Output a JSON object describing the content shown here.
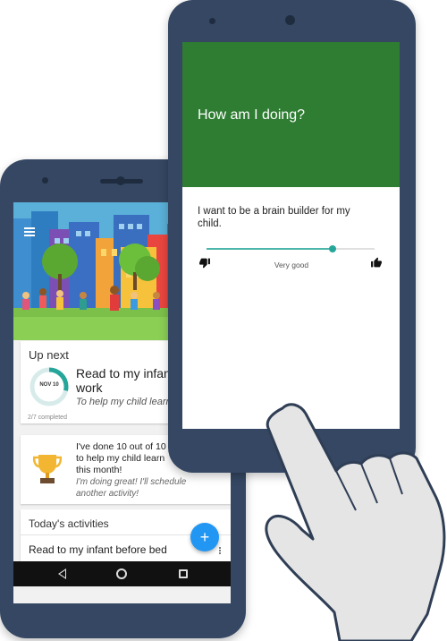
{
  "back_phone": {
    "up_next": {
      "title": "Up next",
      "date": "NOV 10",
      "progress": 0.2857,
      "activity_title": "Read to my infant\nwork",
      "activity_goal": "To help my child learn",
      "completed": "2/7 completed"
    },
    "achievement": {
      "text": "I've done 10 out of 10\nto help my child learn\nthis month!",
      "subtext": "I'm doing great! I'll schedule\nanother activity!"
    },
    "today": {
      "title": "Today's activities",
      "item": "Read to my infant before bed"
    },
    "fab_label": "+"
  },
  "front_phone": {
    "title": "How am I doing?",
    "statement": "I want to be a brain builder for my\nchild.",
    "slider_value": 0.75,
    "rating_label": "Very good"
  },
  "colors": {
    "header_green": "#2e7d32",
    "phone_body": "#354762",
    "slider_teal": "#26a69a",
    "fab_blue": "#2196f3"
  }
}
